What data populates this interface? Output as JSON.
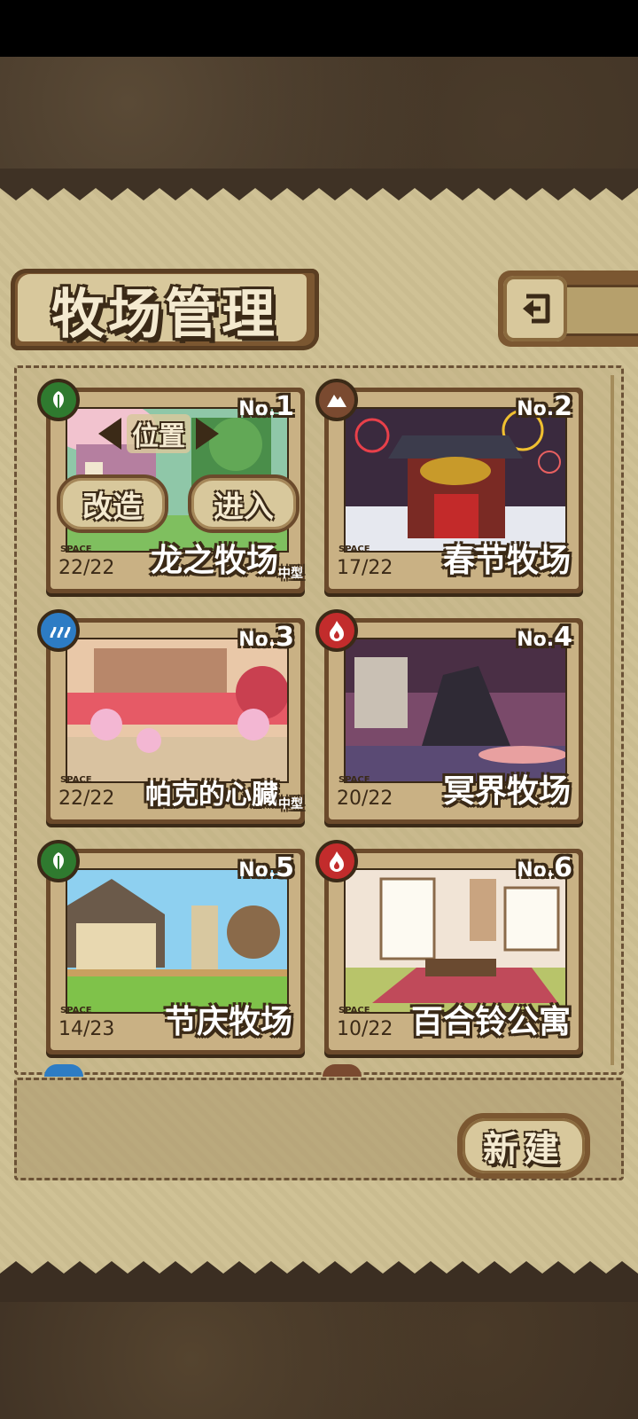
{
  "screen": {
    "title": "牧场管理",
    "back_icon": "return-arrow-icon",
    "new_button": "新建"
  },
  "selected_overlay": {
    "position_label": "位置",
    "modify_button": "改造",
    "enter_button": "进入"
  },
  "ranches": [
    {
      "no_prefix": "No.",
      "no": "1",
      "name": "龙之牧场",
      "size_tag": "中型",
      "space_label": "SPACE",
      "space": "22/22",
      "element": "leaf",
      "element_color": "#2f7a2f"
    },
    {
      "no_prefix": "No.",
      "no": "2",
      "name": "春节牧场",
      "size_tag": "",
      "space_label": "SPACE",
      "space": "17/22",
      "element": "mountain",
      "element_color": "#7a4a30"
    },
    {
      "no_prefix": "No.",
      "no": "3",
      "name": "帕克的心臓",
      "size_tag": "中型",
      "space_label": "SPACE",
      "space": "22/22",
      "element": "water",
      "element_color": "#2d7cc4"
    },
    {
      "no_prefix": "No.",
      "no": "4",
      "name": "冥界牧场",
      "size_tag": "",
      "space_label": "SPACE",
      "space": "20/22",
      "element": "fire",
      "element_color": "#c22c2c"
    },
    {
      "no_prefix": "No.",
      "no": "5",
      "name": "节庆牧场",
      "size_tag": "",
      "space_label": "SPACE",
      "space": "14/23",
      "element": "leaf",
      "element_color": "#2f7a2f"
    },
    {
      "no_prefix": "No.",
      "no": "6",
      "name": "百合铃公寓",
      "size_tag": "",
      "space_label": "SPACE",
      "space": "10/22",
      "element": "fire",
      "element_color": "#c22c2c"
    }
  ],
  "colors": {
    "parchment": "#cfc195",
    "frame_brown": "#6b4a2b",
    "outline_dark": "#3b2a17"
  }
}
